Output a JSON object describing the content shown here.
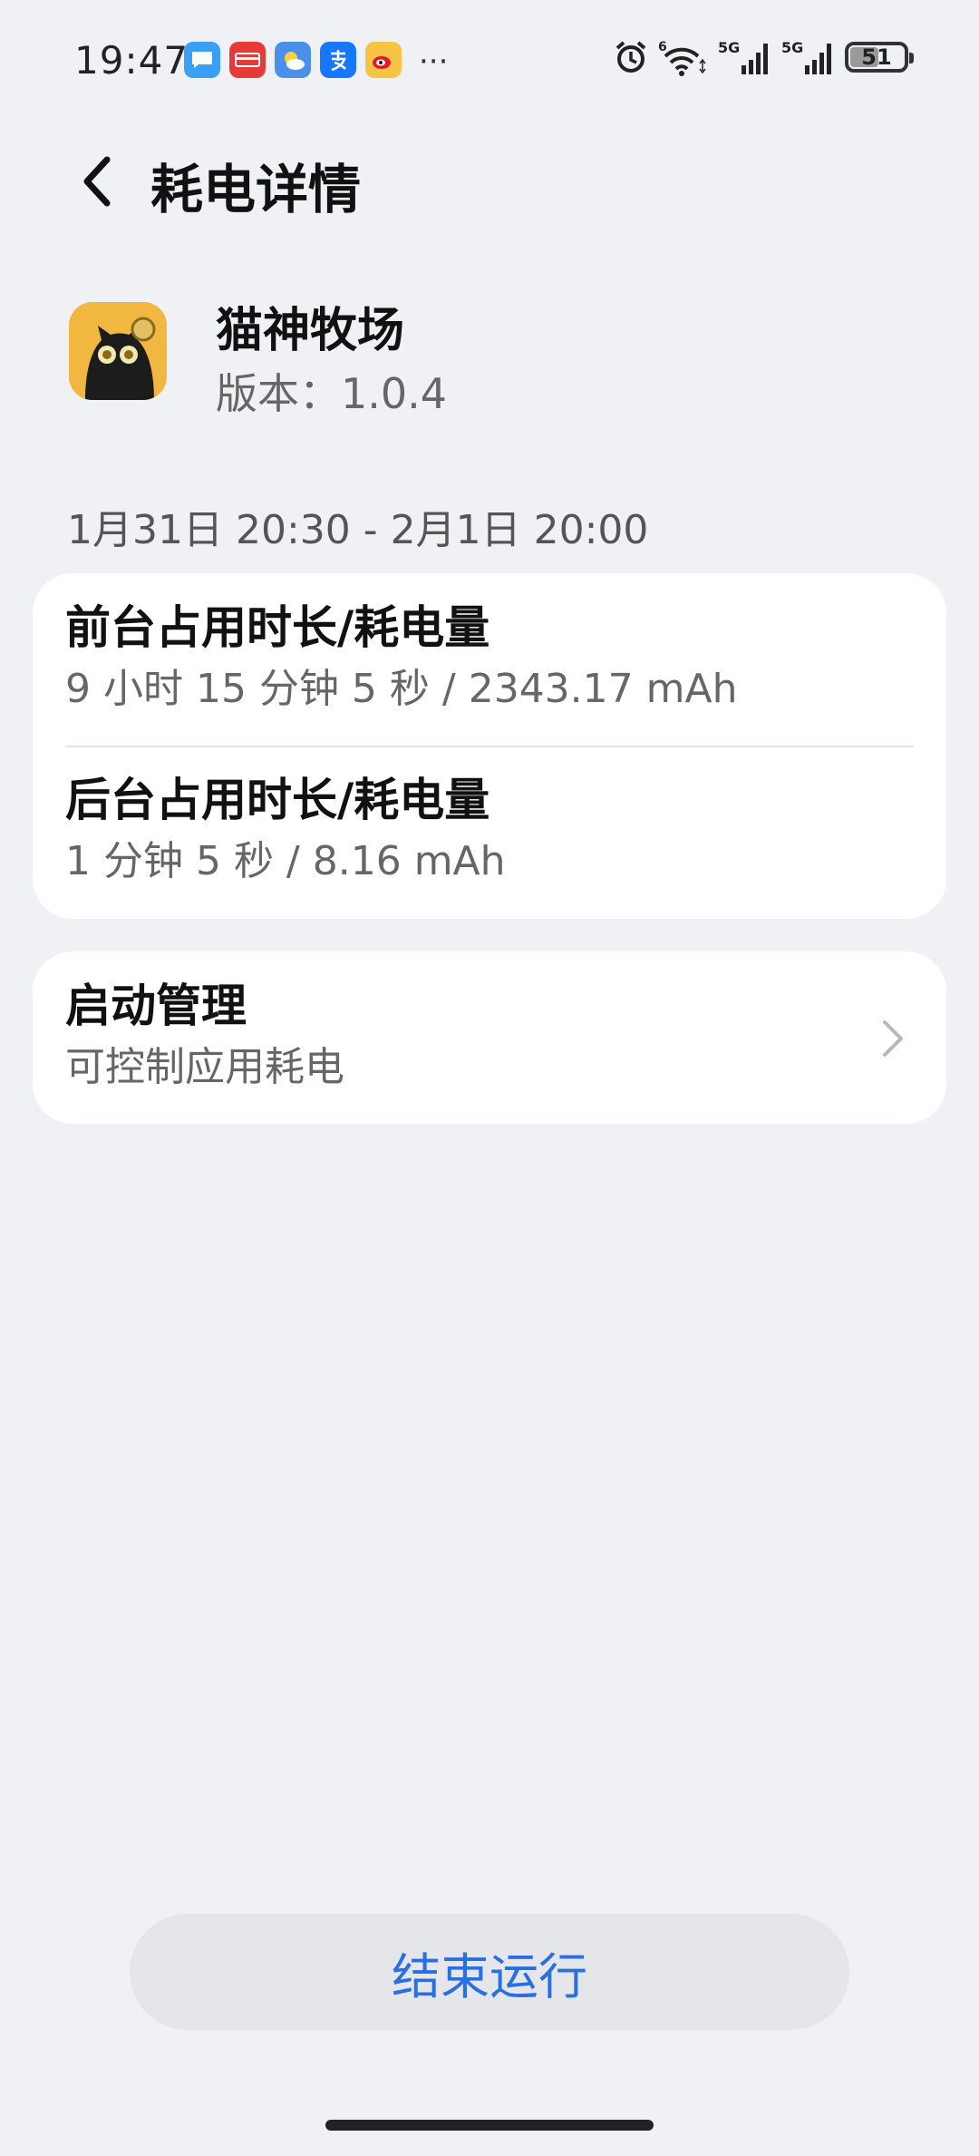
{
  "status_bar": {
    "time": "19:47",
    "notification_icons": [
      "message-icon",
      "union-pay-icon",
      "weather-icon",
      "alipay-icon",
      "weibo-icon"
    ],
    "more": "···",
    "system_icons": [
      "alarm-icon",
      "wifi-icon",
      "signal-5g-icon",
      "signal-5g-icon"
    ],
    "wifi_badge": "6",
    "sim1_label": "5G",
    "sim2_label": "5G",
    "battery_level": "51"
  },
  "header": {
    "title": "耗电详情"
  },
  "app": {
    "name": "猫神牧场",
    "version": "版本：1.0.4"
  },
  "date_range": "1月31日 20:30 - 2月1日 20:00",
  "usage": {
    "foreground_title": "前台占用时长/耗电量",
    "foreground_value": "9 小时 15 分钟 5 秒 / 2343.17 mAh",
    "background_title": "后台占用时长/耗电量",
    "background_value": "1 分钟 5 秒 / 8.16 mAh"
  },
  "startup": {
    "title": "启动管理",
    "subtitle": "可控制应用耗电"
  },
  "end_button": "结束运行",
  "colors": {
    "background": "#f0f1f5",
    "card": "#ffffff",
    "accent": "#2a6fe0",
    "secondary_text": "#666666"
  }
}
